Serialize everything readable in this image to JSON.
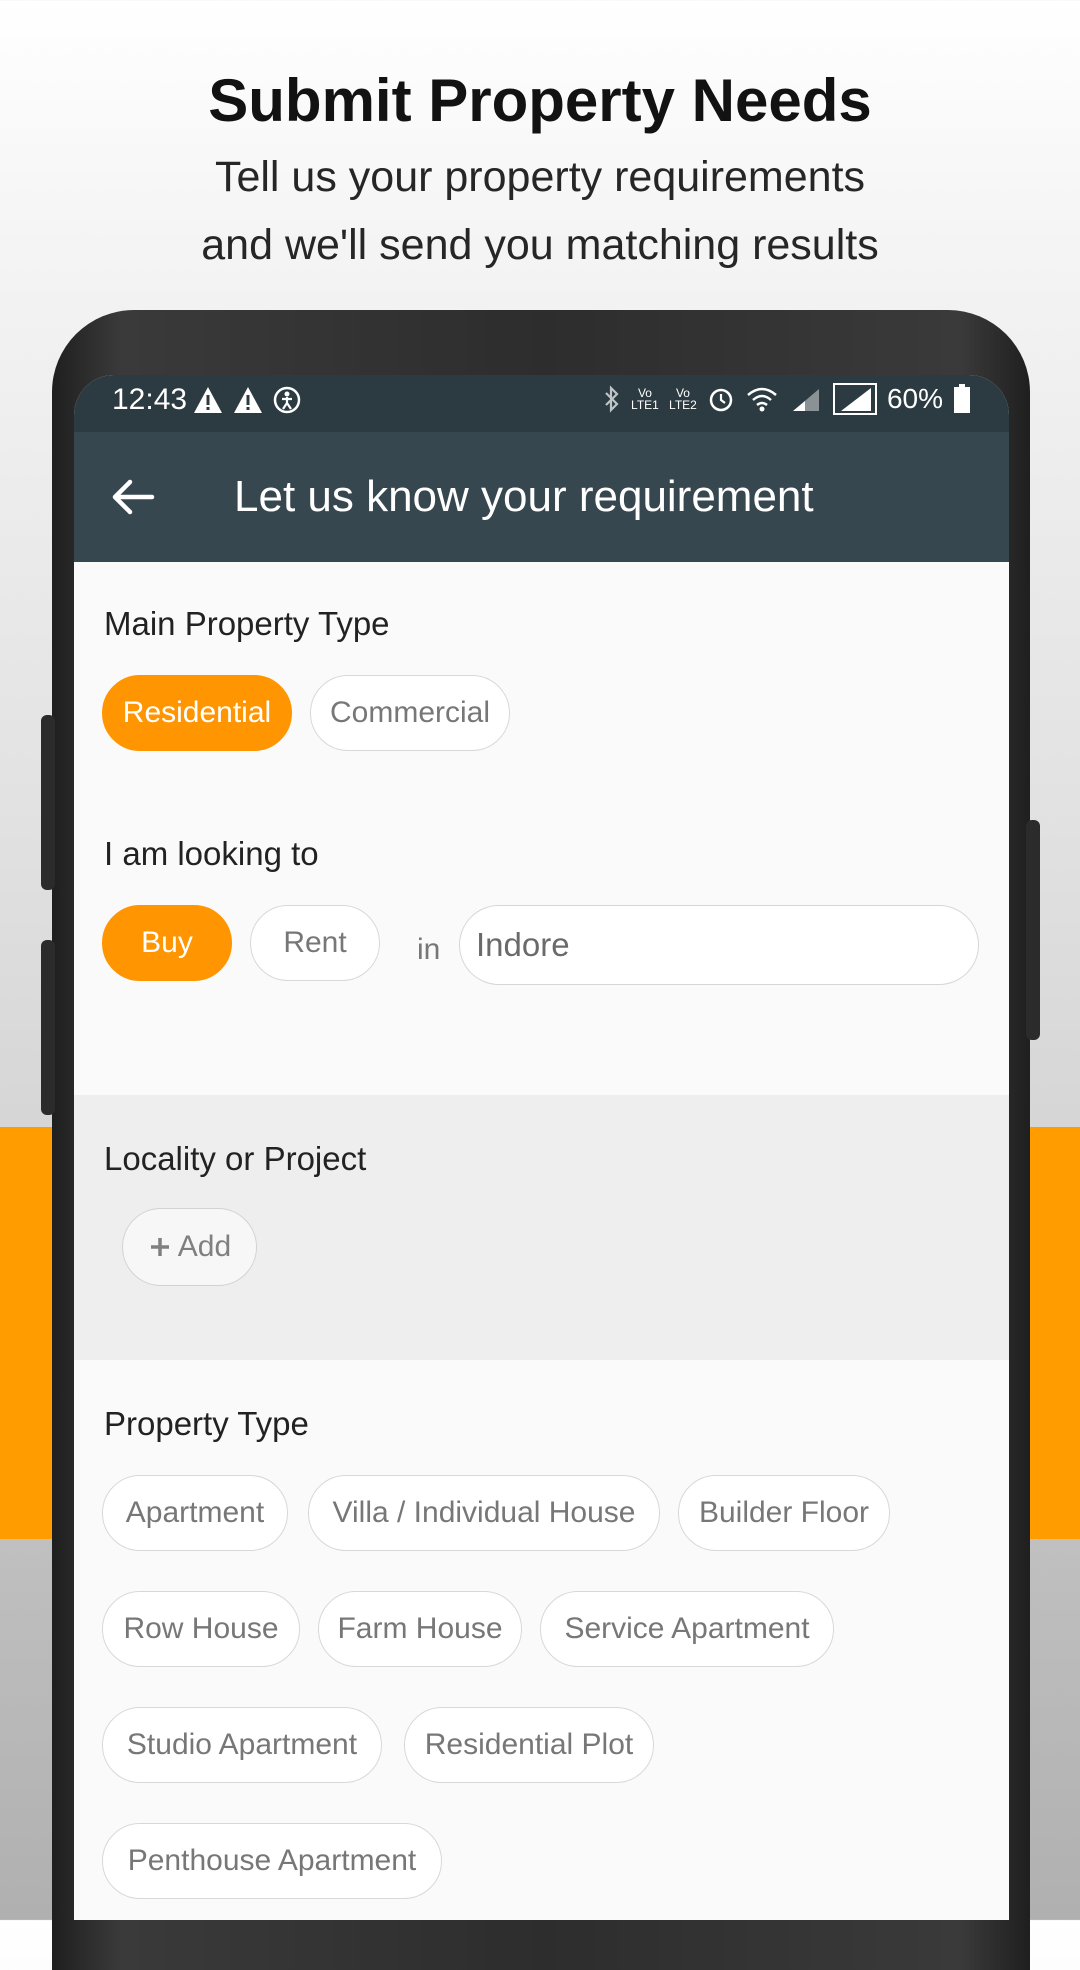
{
  "promo": {
    "title": "Submit Property Needs",
    "subtitle_line1": "Tell us your property requirements",
    "subtitle_line2": "and we'll send you matching results"
  },
  "status_bar": {
    "time": "12:43",
    "lte1": "Vo LTE1",
    "lte2": "Vo LTE2",
    "battery": "60%",
    "icons": [
      "warning-icon",
      "warning-icon",
      "accessibility-icon",
      "bluetooth-icon",
      "alarm-icon",
      "wifi-icon",
      "signal-icon",
      "signal-icon",
      "battery-icon"
    ]
  },
  "app_bar": {
    "title": "Let us know your requirement",
    "back_icon": "arrow-left-icon"
  },
  "main_property_type": {
    "label": "Main Property Type",
    "options": [
      "Residential",
      "Commercial"
    ],
    "selected": "Residential"
  },
  "looking_to": {
    "label": "I am looking to",
    "options": [
      "Buy",
      "Rent"
    ],
    "selected": "Buy",
    "in_label": "in",
    "city_value": "Indore"
  },
  "locality": {
    "label": "Locality or Project",
    "add_label": "Add"
  },
  "property_type": {
    "label": "Property Type",
    "options": [
      "Apartment",
      "Villa / Individual House",
      "Builder Floor",
      "Row House",
      "Farm House",
      "Service Apartment",
      "Studio Apartment",
      "Residential Plot",
      "Penthouse Apartment"
    ]
  },
  "colors": {
    "accent": "#ff9500",
    "app_bar": "#37474f",
    "status_bar": "#2c3a41"
  }
}
